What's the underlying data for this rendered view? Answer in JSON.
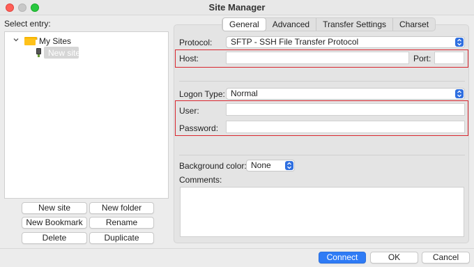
{
  "window": {
    "title": "Site Manager"
  },
  "left": {
    "select_entry_label": "Select entry:",
    "tree": {
      "root_label": "My Sites",
      "site_label": "New site"
    },
    "buttons": {
      "new_site": "New site",
      "new_folder": "New folder",
      "new_bookmark": "New Bookmark",
      "rename": "Rename",
      "delete": "Delete",
      "duplicate": "Duplicate"
    }
  },
  "tabs": [
    "General",
    "Advanced",
    "Transfer Settings",
    "Charset"
  ],
  "active_tab": "General",
  "general": {
    "protocol_label": "Protocol:",
    "protocol_value": "SFTP - SSH File Transfer Protocol",
    "host_label": "Host:",
    "host_value": "",
    "port_label": "Port:",
    "port_value": "",
    "logon_type_label": "Logon Type:",
    "logon_type_value": "Normal",
    "user_label": "User:",
    "user_value": "",
    "password_label": "Password:",
    "password_value": "",
    "background_color_label": "Background color:",
    "background_color_value": "None",
    "comments_label": "Comments:",
    "comments_value": ""
  },
  "footer": {
    "connect": "Connect",
    "ok": "OK",
    "cancel": "Cancel"
  },
  "colors": {
    "accent": "#2f7bf5",
    "highlight_border": "#d9262e",
    "folder": "#ffc21a"
  },
  "icons": {
    "tree_toggle": "chevron-down-icon",
    "folder": "folder-icon",
    "site": "site-icon",
    "select_stepper": "up-down-chevron-icon"
  }
}
